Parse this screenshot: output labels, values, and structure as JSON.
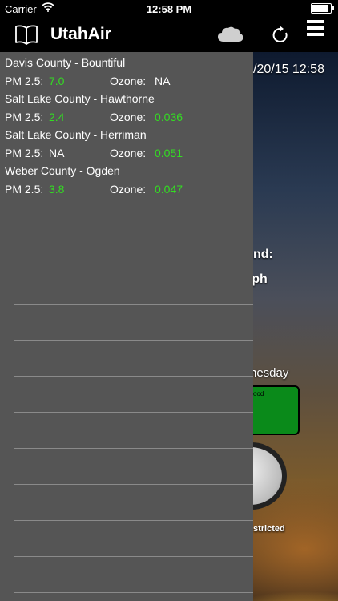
{
  "status_bar": {
    "carrier": "Carrier",
    "time": "12:58 PM"
  },
  "nav": {
    "title": "UtahAir",
    "icons": [
      "book-icon",
      "cloud-icon",
      "refresh-icon",
      "menu-icon"
    ]
  },
  "stations": [
    {
      "name": "Davis County - Bountiful",
      "pm_label": "PM 2.5:",
      "pm": "7.0",
      "ozone_label": "Ozone:",
      "ozone": "NA"
    },
    {
      "name": "Salt Lake County - Hawthorne",
      "pm_label": "PM 2.5:",
      "pm": "2.4",
      "ozone_label": "Ozone:",
      "ozone": "0.036"
    },
    {
      "name": "Salt Lake County - Herriman",
      "pm_label": "PM 2.5:",
      "pm": "NA",
      "ozone_label": "Ozone:",
      "ozone": "0.051"
    },
    {
      "name": "Weber County - Ogden",
      "pm_label": "PM 2.5:",
      "pm": "3.8",
      "ozone_label": "Ozone:",
      "ozone": "0.047"
    }
  ],
  "background": {
    "date_fragment": "/20/15 12:58",
    "wind_fragment": "nd:",
    "speed_fragment": "mph",
    "day_fragment": "nesday",
    "aqi_fragment": "ood",
    "restriction_fragment": "stricted"
  },
  "colors": {
    "good_value": "#33dd22",
    "drawer": "#555555",
    "aqi_good": "#0a8a1a"
  }
}
